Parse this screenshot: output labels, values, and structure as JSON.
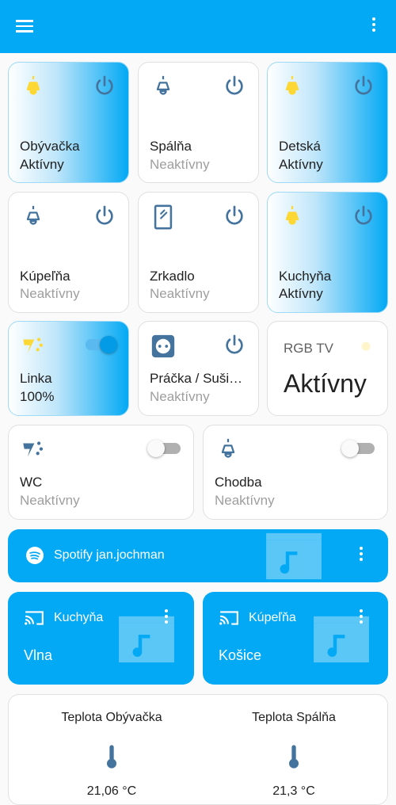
{
  "appbar": {
    "menu_icon": "hamburger-menu-icon",
    "more_icon": "more-vertical-icon"
  },
  "colors": {
    "primary": "#03a9f4",
    "active_bulb": "#fdd835",
    "inactive_icon": "#44739e",
    "muted_text": "#9e9e9e"
  },
  "tiles": [
    {
      "name": "Obývačka",
      "state": "Aktívny",
      "icon": "ceiling-light-icon",
      "active": true
    },
    {
      "name": "Spálňa",
      "state": "Neaktívny",
      "icon": "ceiling-light-icon",
      "active": false
    },
    {
      "name": "Detská",
      "state": "Aktívny",
      "icon": "ceiling-light-icon",
      "active": true
    },
    {
      "name": "Kúpeľňa",
      "state": "Neaktívny",
      "icon": "ceiling-light-icon",
      "active": false
    },
    {
      "name": "Zrkadlo",
      "state": "Neaktívny",
      "icon": "mirror-icon",
      "active": false
    },
    {
      "name": "Kuchyňa",
      "state": "Aktívny",
      "icon": "ceiling-light-icon",
      "active": true
    },
    {
      "name": "Linka",
      "state": "100%",
      "icon": "led-strip-icon",
      "active": true,
      "toggle": true
    },
    {
      "name": "Práčka / Sušička",
      "state": "Neaktívny",
      "icon": "power-socket-icon",
      "active": false
    },
    {
      "name": "RGB TV",
      "state": "Aktívny",
      "icon": "bulb-icon",
      "active": true
    },
    {
      "name": "WC",
      "state": "Neaktívny",
      "icon": "led-strip-icon",
      "active": false,
      "toggle": false
    },
    {
      "name": "Chodba",
      "state": "Neaktívny",
      "icon": "ceiling-light-icon",
      "active": false,
      "toggle": false
    }
  ],
  "media": {
    "spotify": {
      "label": "Spotify jan.jochman",
      "icon": "spotify-icon"
    },
    "cast": [
      {
        "room": "Kuchyňa",
        "title": "Vlna",
        "icon": "cast-icon"
      },
      {
        "room": "Kúpeľňa",
        "title": "Košice",
        "icon": "cast-icon"
      }
    ]
  },
  "sensors": [
    {
      "title": "Teplota Obývačka",
      "value": "21,06 °C",
      "icon": "thermometer-icon"
    },
    {
      "title": "Teplota Spálňa",
      "value": "21,3 °C",
      "icon": "thermometer-icon"
    }
  ]
}
